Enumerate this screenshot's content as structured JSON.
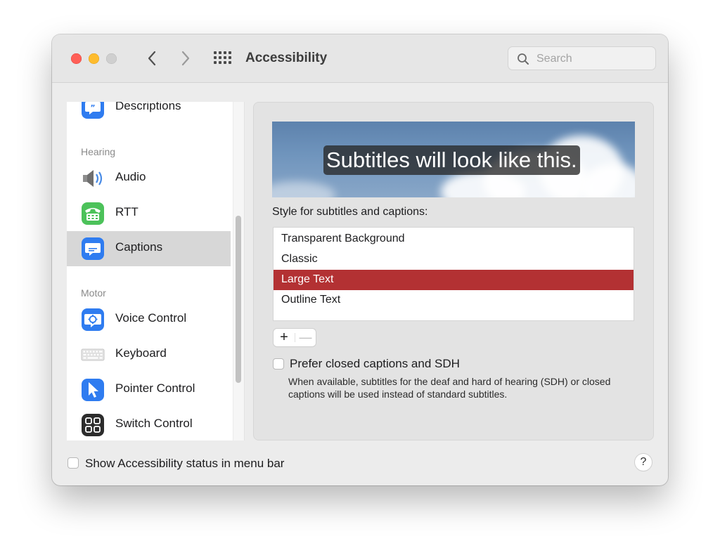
{
  "window": {
    "title": "Accessibility"
  },
  "search": {
    "placeholder": "Search",
    "value": ""
  },
  "sidebar": {
    "items": [
      {
        "label": "Descriptions",
        "icon": "descriptions-icon"
      },
      {
        "label": "Audio",
        "icon": "speaker-icon"
      },
      {
        "label": "RTT",
        "icon": "rtt-icon"
      },
      {
        "label": "Captions",
        "icon": "captions-icon",
        "selected": true
      },
      {
        "label": "Voice Control",
        "icon": "voice-control-icon"
      },
      {
        "label": "Keyboard",
        "icon": "keyboard-icon"
      },
      {
        "label": "Pointer Control",
        "icon": "pointer-icon"
      },
      {
        "label": "Switch Control",
        "icon": "switch-control-icon"
      }
    ],
    "sections": {
      "hearing": "Hearing",
      "motor": "Motor"
    }
  },
  "captions": {
    "preview_text": "Subtitles will look like this.",
    "style_label": "Style for subtitles and captions:",
    "styles": [
      "Transparent Background",
      "Classic",
      "Large Text",
      "Outline Text"
    ],
    "selected_style": "Large Text",
    "add_label": "+",
    "remove_label": "—",
    "prefer_cc_label": "Prefer closed captions and SDH",
    "prefer_cc_checked": false,
    "prefer_cc_description": "When available, subtitles for the deaf and hard of hearing (SDH) or closed captions will be used instead of standard subtitles."
  },
  "footer": {
    "status_label": "Show Accessibility status in menu bar",
    "status_checked": false,
    "help_label": "?"
  },
  "colors": {
    "selection_red": "#b33133",
    "close": "#ff5f57",
    "minimize": "#febc2e",
    "zoom_inactive": "#cfcfcf",
    "icon_blue": "#2f7cf0",
    "rtt_green": "#4cc25a"
  }
}
